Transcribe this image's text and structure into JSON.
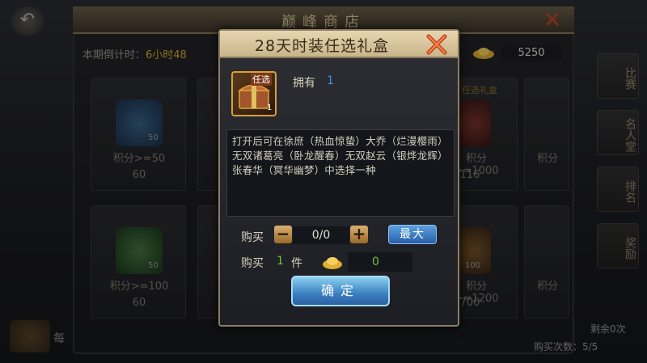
{
  "shop": {
    "title": "巅峰商店",
    "countdown_label": "本期倒计时：",
    "countdown_value": "6小时48",
    "gold_amount": "5250",
    "side_tabs": [
      "比赛",
      "名人堂",
      "排名",
      "奖励"
    ],
    "cards": [
      {
        "score": "积分>=50",
        "price": "60",
        "stack": "50"
      },
      {
        "score": "积分>=1000",
        "price": "116",
        "label": "任选礼盒"
      },
      {
        "score": "积分",
        "price": ""
      },
      {
        "score": "积分>=100",
        "price": "60",
        "stack": "50"
      },
      {
        "score": "积分>=1200",
        "price": "700",
        "stack": "100"
      },
      {
        "score": "积分",
        "price": ""
      }
    ],
    "bottom_text": "每",
    "remaining": "剩余0次",
    "buy_count": "购买次数：5/5"
  },
  "dialog": {
    "title": "28天时装任选礼盒",
    "item_tag": "任选",
    "item_count": "1",
    "own_label": "拥有",
    "own_value": "1",
    "description": "打开后可在徐庶（热血惊蛰）大乔（烂漫樱雨）无双诸葛亮（卧龙醒春）无双赵云（银烨龙辉）张春华（冥华幽梦）中选择一种",
    "buy_label": "购买",
    "quantity": "0/0",
    "max_label": "最大",
    "buy2_label": "购买",
    "buy2_qty": "1",
    "buy2_unit": "件",
    "cost": "0",
    "confirm_label": "确定"
  },
  "colors": {
    "accent_gold": "#d4a13a",
    "own_value": "#4a8fe0",
    "green_value": "#6ec23a",
    "confirm_blue": "#3a80c0"
  }
}
